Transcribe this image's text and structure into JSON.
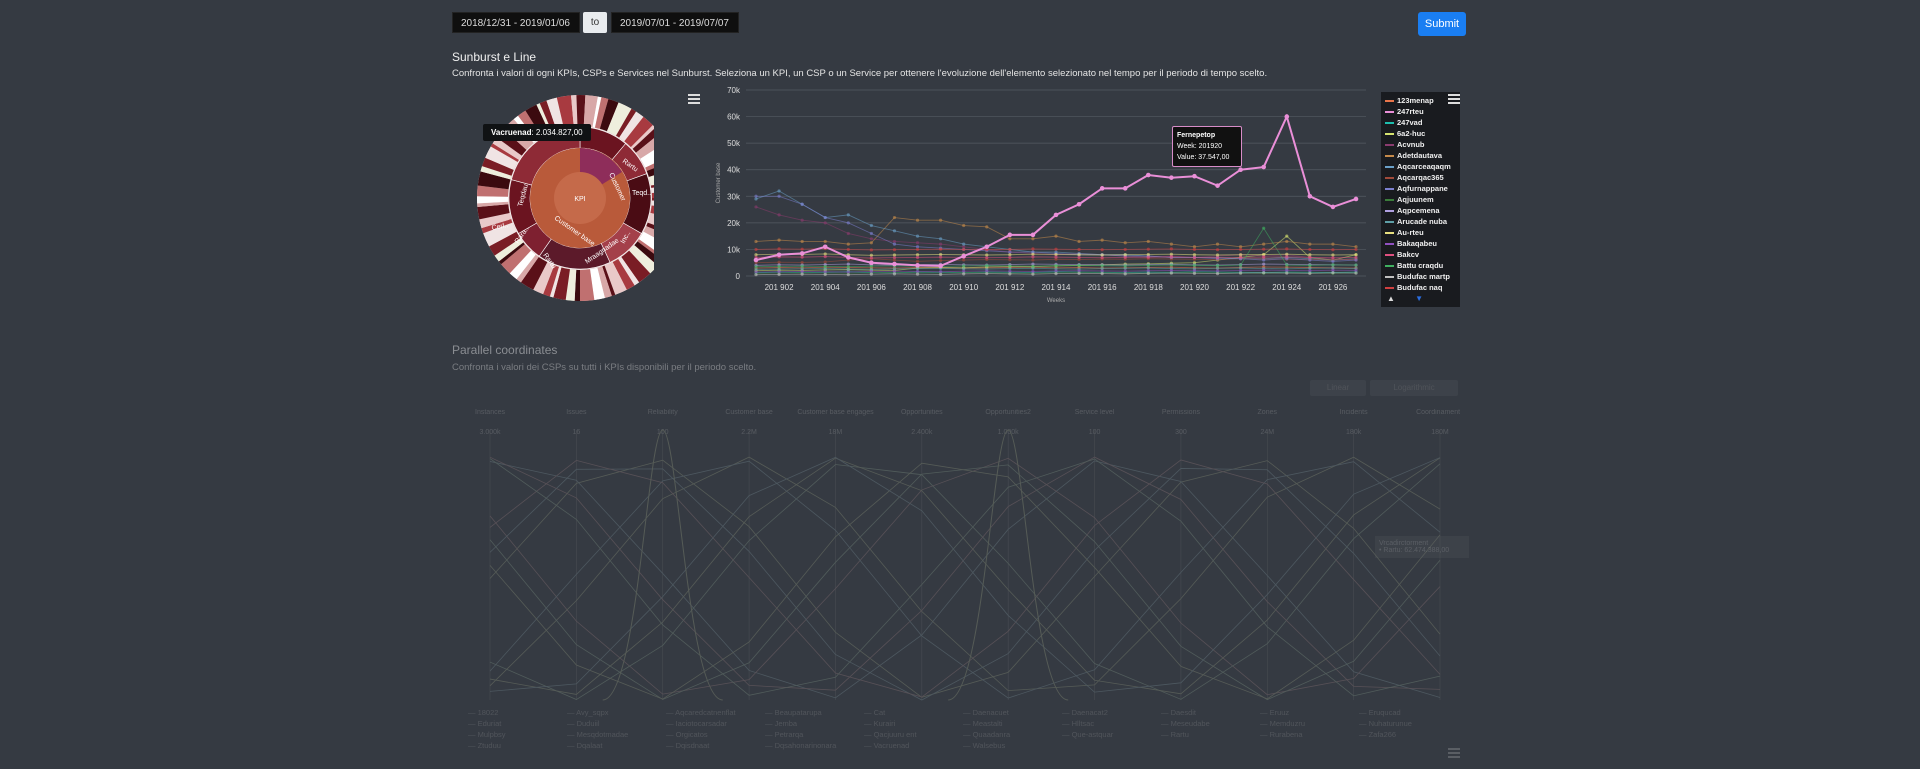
{
  "filters": {
    "range_start": "2018/12/31 - 2019/01/06",
    "to_label": "to",
    "range_end": "2019/07/01 - 2019/07/07",
    "submit_label": "Submit"
  },
  "sunburst_section": {
    "title": "Sunburst e Line",
    "description": "Confronta i valori di ogni KPIs, CSPs e Services nel Sunburst. Seleziona un KPI, un CSP o un Service per ottenere l'evoluzione dell'elemento selezionato nel tempo per il periodo di tempo scelto.",
    "sunburst": {
      "center_label": "KPI",
      "labels": [
        "Customer base",
        "Customer",
        "Teqdau",
        "Rartu",
        "Mraagnadae",
        "Teqd..",
        "Cerl..",
        "Rara..",
        "Rartu",
        "Inc.."
      ],
      "tooltip_name": "Vacruenad",
      "tooltip_value": "2.034.827,00",
      "menu_icon": "hamburger-menu-icon"
    },
    "line_chart_tooltip": {
      "name": "Fernepetop",
      "week_label": "Week: 201920",
      "value_label": "Value: 37.547,00"
    },
    "legend_nav_up": "▲",
    "legend_nav_down": "▼"
  },
  "chart_data": {
    "type": "line",
    "ylabel": "Customer base",
    "xlabel": "Weeks",
    "ylim": [
      0,
      70000
    ],
    "y_ticks": [
      "0",
      "10k",
      "20k",
      "30k",
      "40k",
      "50k",
      "60k",
      "70k"
    ],
    "x": [
      "201901",
      "201902",
      "201903",
      "201904",
      "201905",
      "201906",
      "201907",
      "201908",
      "201909",
      "201910",
      "201911",
      "201912",
      "201913",
      "201914",
      "201915",
      "201916",
      "201917",
      "201918",
      "201919",
      "201920",
      "201921",
      "201922",
      "201923",
      "201924",
      "201925",
      "201926",
      "201927"
    ],
    "x_tick_labels": [
      "201 902",
      "201 904",
      "201 906",
      "201 908",
      "201 910",
      "201 912",
      "201 914",
      "201 916",
      "201 918",
      "201 920",
      "201 922",
      "201 924",
      "201 926"
    ],
    "series": [
      {
        "name": "123menap",
        "color": "#e8754a",
        "values": [
          3000,
          3200,
          3100,
          3300,
          3200,
          3100,
          3000,
          3200,
          3100,
          3000,
          3100,
          3200,
          3300,
          3100,
          3200,
          3000,
          3100,
          3200,
          3300,
          3100,
          3000,
          3200,
          3400,
          3300,
          3200,
          3100,
          3000
        ]
      },
      {
        "name": "247rteu",
        "color": "#ea8fd8",
        "values": [
          6000,
          8000,
          8500,
          11000,
          7000,
          5000,
          4500,
          4000,
          3800,
          7500,
          11000,
          15500,
          15500,
          23000,
          27000,
          33000,
          33000,
          38000,
          37000,
          37547,
          34000,
          40000,
          41000,
          60000,
          30000,
          26000,
          29000
        ]
      },
      {
        "name": "247vad",
        "color": "#1ebfae",
        "values": [
          1200,
          1500,
          1300,
          1400,
          1600,
          1300,
          1200,
          1500,
          1400,
          1300,
          1500,
          1400,
          1300,
          1600,
          1500,
          1400,
          1300,
          1500,
          1400,
          1600,
          1500,
          1400,
          1300,
          1500,
          1400,
          1300,
          1500
        ]
      },
      {
        "name": "6a2-huc",
        "color": "#d6e36f",
        "values": [
          2000,
          2200,
          2100,
          2300,
          2400,
          2200,
          2100,
          3000,
          3200,
          3100,
          3400,
          3600,
          3500,
          3800,
          4000,
          4200,
          4500,
          4600,
          4800,
          5000,
          6000,
          7000,
          8000,
          15000,
          7000,
          6000,
          8000
        ]
      },
      {
        "name": "Acvnub",
        "color": "#8a3b6e",
        "values": [
          26000,
          23000,
          21000,
          20000,
          16000,
          14000,
          13000,
          12500,
          12000,
          11000,
          10000,
          9000,
          8500,
          8000,
          8500,
          8000,
          7500,
          7000,
          7500,
          7000,
          7500,
          8000,
          7500,
          8000,
          7000,
          6500,
          6000
        ]
      },
      {
        "name": "Adetdautava",
        "color": "#c58a4a",
        "values": [
          13000,
          13500,
          13000,
          13000,
          12000,
          12500,
          22000,
          21000,
          21000,
          19000,
          18500,
          14000,
          14000,
          15000,
          13000,
          13500,
          12500,
          13000,
          12000,
          11000,
          12000,
          11000,
          12000,
          13000,
          12000,
          12000,
          11000
        ]
      },
      {
        "name": "Aqcarceaqaqm",
        "color": "#6aa0c8",
        "values": [
          29000,
          32000,
          27000,
          22000,
          23000,
          19000,
          17000,
          15000,
          14000,
          12000,
          11000,
          10000,
          9000,
          9000,
          8500,
          8000,
          8000,
          7500,
          7000,
          7000,
          7000,
          6500,
          6500,
          7000,
          6500,
          6000,
          6500
        ]
      },
      {
        "name": "Aqcarqac365",
        "color": "#a04a3a",
        "values": [
          5000,
          5200,
          5100,
          5300,
          6000,
          6500,
          6000,
          5500,
          5800,
          6000,
          6200,
          6100,
          6000,
          6300,
          6200,
          6400,
          6300,
          6500,
          6400,
          6300,
          6200,
          6500,
          6400,
          6300,
          6200,
          6100,
          6300
        ]
      },
      {
        "name": "Aqfurnappane",
        "color": "#7b7fcf",
        "values": [
          30000,
          30000,
          27000,
          22000,
          20000,
          16000,
          12000,
          11000,
          10500,
          10000,
          9500,
          9000,
          9000,
          8500,
          8000,
          8000,
          7500,
          7500,
          7000,
          7000,
          6500,
          6500,
          6000,
          6500,
          6000,
          5500,
          6000
        ]
      },
      {
        "name": "Aqjuunem",
        "color": "#3b7d3b",
        "values": [
          1000,
          1100,
          1200,
          1100,
          1000,
          1200,
          1300,
          1200,
          1100,
          1300,
          1200,
          1100,
          1000,
          1200,
          1300,
          1200,
          1100,
          1000,
          1200,
          1300,
          1200,
          1100,
          1000,
          1200,
          1100,
          1000,
          1200
        ]
      },
      {
        "name": "Aqpcemena",
        "color": "#b0a0e0",
        "values": [
          4000,
          4200,
          4100,
          4300,
          4500,
          4200,
          4100,
          4300,
          4400,
          4200,
          4100,
          4300,
          4500,
          4400,
          4300,
          4200,
          4100,
          4300,
          4400,
          4200,
          4100,
          4300,
          4500,
          4400,
          4300,
          4200,
          4100
        ]
      },
      {
        "name": "Arucade nuba",
        "color": "#5fa0a8",
        "values": [
          2500,
          2600,
          2700,
          2800,
          2600,
          2500,
          2700,
          2800,
          2900,
          2700,
          2600,
          2800,
          2900,
          2700,
          2600,
          2800,
          2900,
          3000,
          2800,
          2700,
          2900,
          3000,
          2800,
          2700,
          2900,
          3000,
          2800
        ]
      },
      {
        "name": "Au-rteu",
        "color": "#e8e080",
        "values": [
          8000,
          8200,
          8100,
          8300,
          8000,
          7800,
          7900,
          8000,
          8100,
          8000,
          7900,
          8000,
          8200,
          8100,
          8000,
          7900,
          8000,
          8100,
          8200,
          8000,
          7900,
          8000,
          8100,
          8200,
          8000,
          7900,
          8000
        ]
      },
      {
        "name": "Bakaqabeu",
        "color": "#9050c0",
        "values": [
          1500,
          1600,
          1700,
          1600,
          1500,
          1700,
          1800,
          1700,
          1600,
          1800,
          1900,
          1800,
          1700,
          1900,
          2000,
          1900,
          1800,
          2000,
          2100,
          2000,
          1900,
          2100,
          2200,
          2100,
          2000,
          2200,
          2100
        ]
      },
      {
        "name": "Bakcv",
        "color": "#e05080",
        "values": [
          7000,
          7200,
          7100,
          7300,
          7000,
          6800,
          6900,
          7000,
          7100,
          7000,
          6900,
          7000,
          7200,
          7100,
          7000,
          6900,
          7000,
          7100,
          7200,
          7000,
          6900,
          7000,
          7100,
          7200,
          7000,
          6900,
          7000
        ]
      },
      {
        "name": "Battu craqdu",
        "color": "#40b060",
        "values": [
          3500,
          3600,
          3700,
          3600,
          3500,
          3700,
          3800,
          3700,
          3600,
          3800,
          3900,
          3800,
          3700,
          3900,
          4000,
          3900,
          3800,
          4000,
          4100,
          4000,
          3900,
          4100,
          18000,
          4100,
          4000,
          4200,
          4100
        ]
      },
      {
        "name": "Budufac martp",
        "color": "#c0c0c0",
        "values": [
          500,
          600,
          700,
          600,
          500,
          700,
          800,
          700,
          600,
          800,
          900,
          800,
          700,
          900,
          1000,
          900,
          800,
          1000,
          1100,
          1000,
          900,
          1100,
          1200,
          1100,
          1000,
          1200,
          1100
        ]
      },
      {
        "name": "Budufac naq",
        "color": "#d04040",
        "values": [
          10000,
          10200,
          10100,
          10300,
          10000,
          9800,
          9900,
          10000,
          10100,
          10000,
          9900,
          10000,
          10200,
          10100,
          10000,
          9900,
          10000,
          10100,
          10200,
          10000,
          9900,
          10000,
          10100,
          10200,
          10000,
          9900,
          10000
        ]
      }
    ]
  },
  "parallel_section": {
    "title": "Parallel coordinates",
    "description": "Confronta i valori dei CSPs su tutti i KPIs disponibili per il periodo scelto.",
    "toggle_linear": "Linear",
    "toggle_log": "Logarithmic",
    "axes": [
      "Instances",
      "Issues",
      "Reliability",
      "Customer base",
      "Customer base engages",
      "Opportunities",
      "Opportunities2",
      "Service level",
      "Permissions",
      "Zones",
      "Incidents",
      "Coordinamento"
    ],
    "top_ticks": [
      "3.000k",
      "16",
      "100",
      "2.2M",
      "18M",
      "2.400k",
      "1.000k",
      "100",
      "300",
      "24M",
      "180k",
      "180M"
    ],
    "tooltip_title": "Vrcadirctorment",
    "tooltip_line": "• Rartu: 62.474.388,00",
    "legend_columns": [
      [
        "18022",
        "Eduriat",
        "Mulpbsy",
        "Ztuduu"
      ],
      [
        "Avy_sqpx",
        "Duduiil",
        "Mesqdotmadae",
        "Dqalaat"
      ],
      [
        "Aqcaredcatnenflat",
        "Iaciotocarsadar",
        "Orgicatos",
        "Dqisdnaat"
      ],
      [
        "Beaupatarupa",
        "Jemba",
        "Petrarqa",
        "Dqsahonarinonara"
      ],
      [
        "Cat",
        "Kurairi",
        "Qacjuuru ent",
        "Vacruenad"
      ],
      [
        "Daenacuet",
        "Meastalti",
        "Quaadanra",
        "Walsebus"
      ],
      [
        "Daenacat2",
        "Hlltsac",
        "Que-astquar"
      ],
      [
        "Daesdit",
        "Meseudabe",
        "Rartu"
      ],
      [
        "Eruuz",
        "Memduzru",
        "Rurabena"
      ],
      [
        "Eruqucad",
        "Nuhaturunue",
        "Zafa266"
      ]
    ]
  }
}
